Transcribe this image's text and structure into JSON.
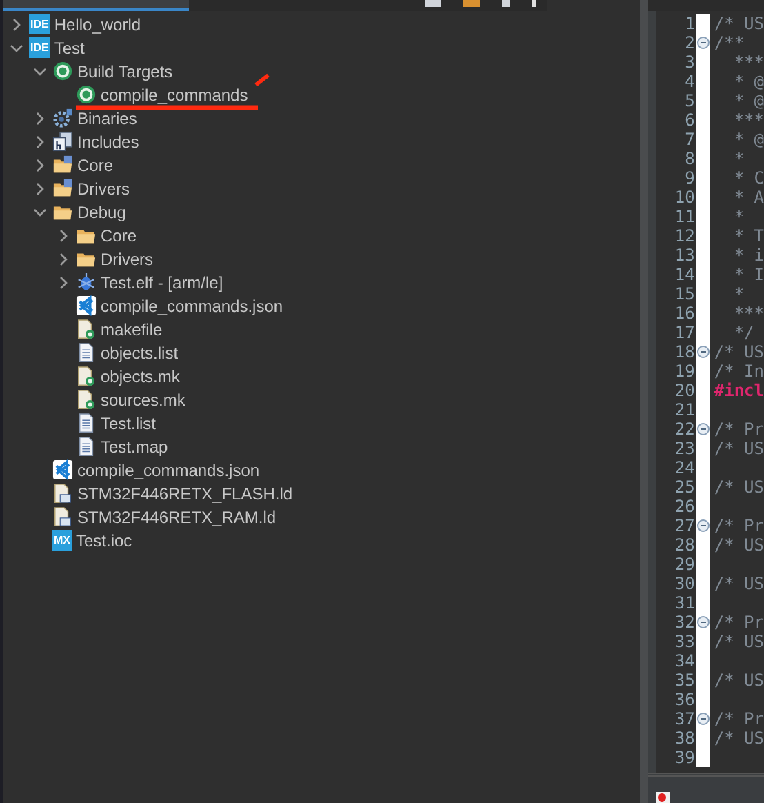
{
  "tree": [
    {
      "label": "Hello_world",
      "kind": "project",
      "badge": "IDE",
      "expanded": false
    },
    {
      "label": "Test",
      "kind": "project",
      "badge": "IDE",
      "expanded": true,
      "children": [
        {
          "label": "Build Targets",
          "kind": "target",
          "expanded": true,
          "children": [
            {
              "label": "compile_commands",
              "kind": "target",
              "marked": true
            }
          ]
        },
        {
          "label": "Binaries",
          "kind": "binaries",
          "expanded": false
        },
        {
          "label": "Includes",
          "kind": "includes",
          "expanded": false
        },
        {
          "label": "Core",
          "kind": "source-folder",
          "expanded": false
        },
        {
          "label": "Drivers",
          "kind": "source-folder",
          "expanded": false
        },
        {
          "label": "Debug",
          "kind": "folder",
          "expanded": true,
          "children": [
            {
              "label": "Core",
              "kind": "folder",
              "expanded": false
            },
            {
              "label": "Drivers",
              "kind": "folder",
              "expanded": false
            },
            {
              "label": "Test.elf - [arm/le]",
              "kind": "elf",
              "expanded": false
            },
            {
              "label": "compile_commands.json",
              "kind": "vscode"
            },
            {
              "label": "makefile",
              "kind": "make"
            },
            {
              "label": "objects.list",
              "kind": "text"
            },
            {
              "label": "objects.mk",
              "kind": "make"
            },
            {
              "label": "sources.mk",
              "kind": "make"
            },
            {
              "label": "Test.list",
              "kind": "text"
            },
            {
              "label": "Test.map",
              "kind": "text"
            }
          ]
        },
        {
          "label": "compile_commands.json",
          "kind": "vscode"
        },
        {
          "label": "STM32F446RETX_FLASH.ld",
          "kind": "linker"
        },
        {
          "label": "STM32F446RETX_RAM.ld",
          "kind": "linker"
        },
        {
          "label": "Test.ioc",
          "kind": "ioc",
          "badge": "MX"
        }
      ]
    }
  ],
  "editor": {
    "lines": [
      {
        "number": "1",
        "text": "/* US",
        "kind": "comment",
        "fold": false
      },
      {
        "number": "2",
        "text": "/**",
        "kind": "comment",
        "fold": true
      },
      {
        "number": "3",
        "text": "  ***",
        "kind": "comment",
        "fold": false
      },
      {
        "number": "4",
        "text": "  * @",
        "kind": "comment",
        "fold": false
      },
      {
        "number": "5",
        "text": "  * @",
        "kind": "comment",
        "fold": false
      },
      {
        "number": "6",
        "text": "  ***",
        "kind": "comment",
        "fold": false
      },
      {
        "number": "7",
        "text": "  * @",
        "kind": "comment",
        "fold": false
      },
      {
        "number": "8",
        "text": "  *",
        "kind": "comment",
        "fold": false
      },
      {
        "number": "9",
        "text": "  * C",
        "kind": "comment",
        "fold": false
      },
      {
        "number": "10",
        "text": "  * A",
        "kind": "comment",
        "fold": false
      },
      {
        "number": "11",
        "text": "  *",
        "kind": "comment",
        "fold": false
      },
      {
        "number": "12",
        "text": "  * T",
        "kind": "comment",
        "fold": false
      },
      {
        "number": "13",
        "text": "  * i",
        "kind": "comment",
        "fold": false
      },
      {
        "number": "14",
        "text": "  * I",
        "kind": "comment",
        "fold": false
      },
      {
        "number": "15",
        "text": "  *",
        "kind": "comment",
        "fold": false
      },
      {
        "number": "16",
        "text": "  ***",
        "kind": "comment",
        "fold": false
      },
      {
        "number": "17",
        "text": "  */",
        "kind": "comment",
        "fold": false
      },
      {
        "number": "18",
        "text": "/* US",
        "kind": "comment",
        "fold": true
      },
      {
        "number": "19",
        "text": "/* In",
        "kind": "comment",
        "fold": false
      },
      {
        "number": "20",
        "text": "#incl",
        "kind": "directive",
        "fold": false
      },
      {
        "number": "21",
        "kind": "blank",
        "fold": false
      },
      {
        "number": "22",
        "text": "/* Pr",
        "kind": "comment",
        "fold": true
      },
      {
        "number": "23",
        "text": "/* US",
        "kind": "comment",
        "fold": false
      },
      {
        "number": "24",
        "kind": "blank",
        "fold": false
      },
      {
        "number": "25",
        "text": "/* US",
        "kind": "comment",
        "fold": false
      },
      {
        "number": "26",
        "kind": "blank",
        "fold": false
      },
      {
        "number": "27",
        "text": "/* Pr",
        "kind": "comment",
        "fold": true
      },
      {
        "number": "28",
        "text": "/* US",
        "kind": "comment",
        "fold": false
      },
      {
        "number": "29",
        "kind": "blank",
        "fold": false
      },
      {
        "number": "30",
        "text": "/* US",
        "kind": "comment",
        "fold": false
      },
      {
        "number": "31",
        "kind": "blank",
        "fold": false
      },
      {
        "number": "32",
        "text": "/* Pr",
        "kind": "comment",
        "fold": true
      },
      {
        "number": "33",
        "text": "/* US",
        "kind": "comment",
        "fold": false
      },
      {
        "number": "34",
        "kind": "blank",
        "fold": false
      },
      {
        "number": "35",
        "text": "/* US",
        "kind": "comment",
        "fold": false
      },
      {
        "number": "36",
        "kind": "blank",
        "fold": false
      },
      {
        "number": "37",
        "text": "/* Pr",
        "kind": "comment",
        "fold": true
      },
      {
        "number": "38",
        "text": "/* US",
        "kind": "comment",
        "fold": false
      },
      {
        "number": "39",
        "kind": "blank",
        "fold": false
      }
    ]
  }
}
